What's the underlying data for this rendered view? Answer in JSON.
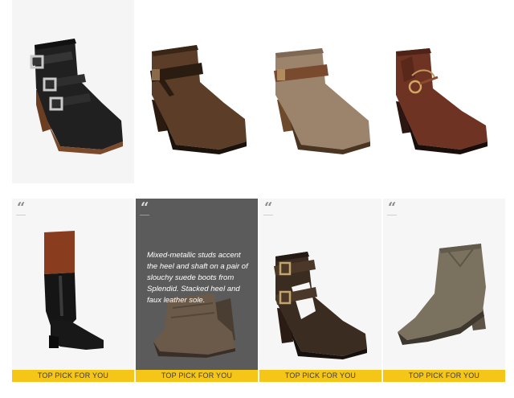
{
  "products": [
    {
      "id": "p1",
      "row": "top",
      "shoe_type": "ankle-bootie-buckles",
      "color": "#1f1f1f"
    },
    {
      "id": "p2",
      "row": "top",
      "shoe_type": "ankle-bootie-strap",
      "color": "#5a3b26"
    },
    {
      "id": "p3",
      "row": "top",
      "shoe_type": "ankle-bootie-strap",
      "color": "#9a8068"
    },
    {
      "id": "p4",
      "row": "top",
      "shoe_type": "ankle-bootie-ring",
      "color": "#6e3322"
    },
    {
      "id": "p5",
      "row": "bottom",
      "shoe_type": "riding-boot",
      "color": "#161616",
      "badge": "TOP PICK FOR YOU"
    },
    {
      "id": "p6",
      "row": "bottom",
      "shoe_type": "slouchy-bootie",
      "color": "#6b5a49",
      "badge": "TOP PICK FOR YOU",
      "blurb": "Mixed-metallic studs accent the heel and shaft on a pair of slouchy suede boots from Splendid. Stacked heel and faux leather sole."
    },
    {
      "id": "p7",
      "row": "bottom",
      "shoe_type": "cutout-bootie",
      "color": "#3b2c22",
      "badge": "TOP PICK FOR YOU"
    },
    {
      "id": "p8",
      "row": "bottom",
      "shoe_type": "suede-bootie",
      "color": "#7b715f",
      "badge": "TOP PICK FOR YOU"
    }
  ],
  "quote_mark": "“",
  "colors": {
    "badge_bg": "#f5c518",
    "dark_tile_bg": "#5b5b5b"
  }
}
